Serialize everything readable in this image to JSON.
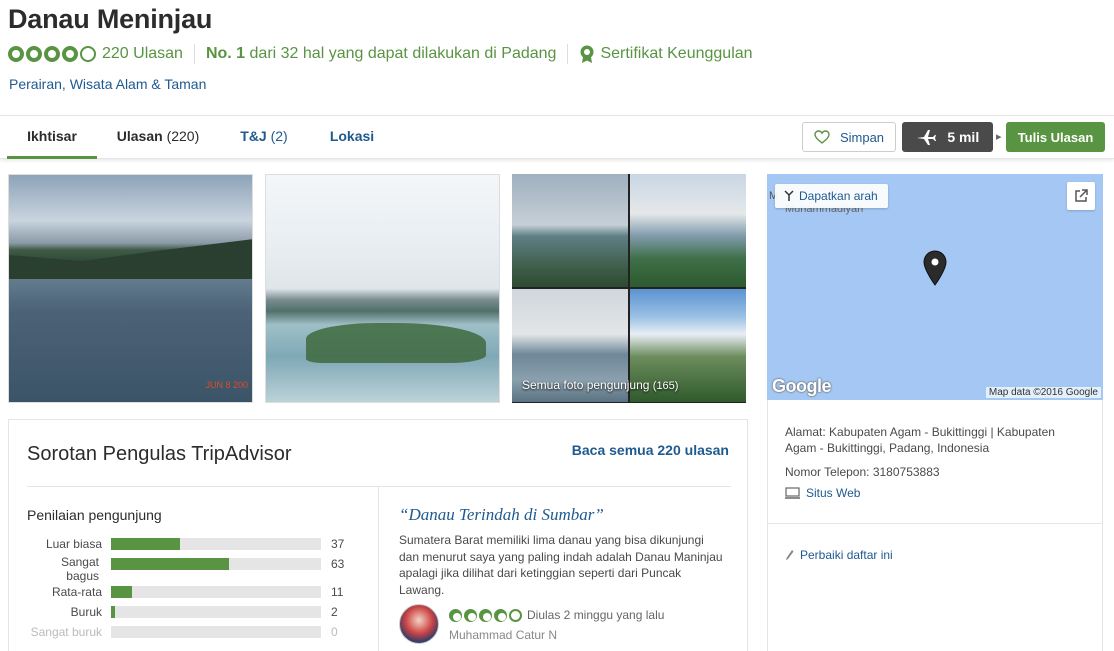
{
  "header": {
    "title": "Danau Meninjau",
    "rating_bubbles": 4,
    "review_count": "220 Ulasan",
    "rank_prefix": "No. 1",
    "rank_suffix": "dari 32 hal yang dapat dilakukan di Padang",
    "certificate": "Sertifikat Keunggulan",
    "categories": "Perairan, Wisata Alam & Taman"
  },
  "tabs": [
    {
      "label": "Ikhtisar"
    },
    {
      "label": "Ulasan",
      "count": "(220)"
    },
    {
      "label": "T&J",
      "count": "(2)"
    },
    {
      "label": "Lokasi"
    }
  ],
  "actions": {
    "save": "Simpan",
    "distance": "5 mil",
    "write_review": "Tulis Ulasan"
  },
  "photos": {
    "date_stamp": "JUN 8 200",
    "all_label": "Semua foto pengunjung",
    "all_count": "(165)"
  },
  "map": {
    "directions": "Dapatkan arah",
    "ghost_label_1": "M",
    "ghost_label_2": "Muhammadiyah",
    "logo": "Google",
    "credit": "Map data ©2016 Google"
  },
  "info": {
    "address": "Alamat: Kabupaten Agam - Bukittinggi | Kabupaten Agam - Bukittinggi, Padang, Indonesia",
    "phone": "Nomor Telepon: 3180753883",
    "website": "Situs Web",
    "edit": "Perbaiki daftar ini"
  },
  "reviews": {
    "title": "Sorotan Pengulas TripAdvisor",
    "read_all": "Baca semua 220 ulasan",
    "ratings_title": "Penilaian pengunjung",
    "ratings": [
      {
        "label": "Luar biasa",
        "count": 37
      },
      {
        "label": "Sangat bagus",
        "count": 63
      },
      {
        "label": "Rata-rata",
        "count": 11
      },
      {
        "label": "Buruk",
        "count": 2
      },
      {
        "label": "Sangat buruk",
        "count": 0
      }
    ],
    "highlight": {
      "quote_title": "“Danau Terindah di Sumbar”",
      "text": "Sumatera Barat memiliki lima danau yang bisa dikunjungi dan menurut saya yang paling indah adalah Danau Maninjau apalagi jika dilihat dari ketinggian seperti dari Puncak Lawang.",
      "rating_bubbles": 4,
      "date": "Diulas 2 minggu yang lalu",
      "reviewer": "Muhammad Catur N"
    }
  },
  "colors": {
    "brand_green": "#589442",
    "link_blue": "#1f5a8f"
  }
}
